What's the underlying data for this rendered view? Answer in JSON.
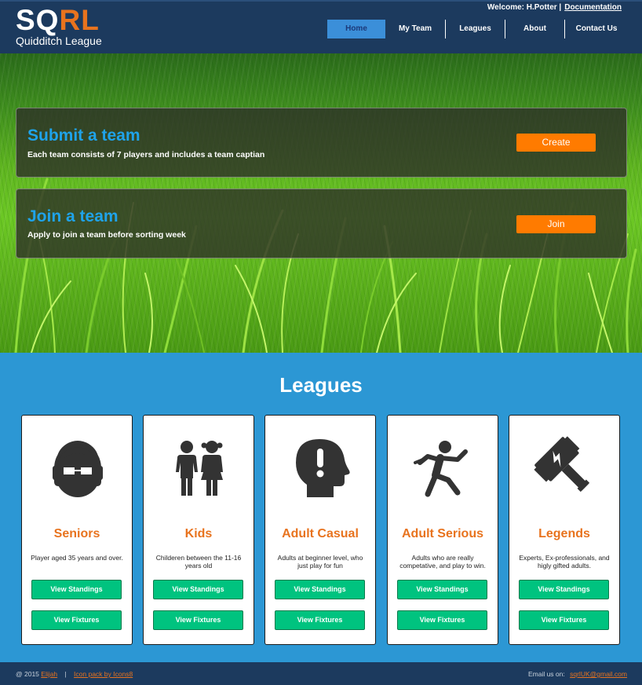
{
  "header": {
    "logo_sq": "SQ",
    "logo_rl": "RL",
    "logo_subtitle": "Quidditch League",
    "welcome_text": "Welcome: H.Potter  |",
    "documentation_link": "Documentation"
  },
  "nav": {
    "items": [
      {
        "label": "Home",
        "active": true
      },
      {
        "label": "My Team",
        "active": false
      },
      {
        "label": "Leagues",
        "active": false
      },
      {
        "label": "About",
        "active": false
      },
      {
        "label": "Contact Us",
        "active": false
      }
    ]
  },
  "hero": {
    "submit": {
      "title": "Submit a team",
      "description": "Each team consists of 7 players and includes a team captian",
      "button": "Create"
    },
    "join": {
      "title": "Join a team",
      "description": "Apply to join a team before sorting week",
      "button": "Join"
    }
  },
  "leagues": {
    "title": "Leagues",
    "cards": [
      {
        "icon": "senior-icon",
        "title": "Seniors",
        "description": "Player aged 35 years and over.",
        "standings_button": "View Standings",
        "fixtures_button": "View Fixtures"
      },
      {
        "icon": "kids-icon",
        "title": "Kids",
        "description": "Childeren between the 11-16 years old",
        "standings_button": "View Standings",
        "fixtures_button": "View Fixtures"
      },
      {
        "icon": "head-exclamation-icon",
        "title": "Adult Casual",
        "description": "Adults at beginner level, who just play for fun",
        "standings_button": "View Standings",
        "fixtures_button": "View Fixtures"
      },
      {
        "icon": "runner-icon",
        "title": "Adult Serious",
        "description": "Adults who are really competative, and play to win.",
        "standings_button": "View Standings",
        "fixtures_button": "View Fixtures"
      },
      {
        "icon": "hammer-icon",
        "title": "Legends",
        "description": "Experts, Ex-professionals, and higly gifted adults.",
        "standings_button": "View Standings",
        "fixtures_button": "View Fixtures"
      }
    ]
  },
  "footer": {
    "copyright": "@ 2015",
    "author_link": "Elijah",
    "separator": "|",
    "icon_credit_link": "Icon pack by Icons8",
    "email_label": "Email us on:",
    "email_link": "sqrlUK@gmail.com"
  },
  "colors": {
    "header_bg": "#1c3a5e",
    "accent_orange": "#e8731e",
    "button_orange": "#ff7b00",
    "title_blue": "#1fa3ea",
    "leagues_bg": "#2c97d4",
    "button_green": "#00c37f"
  }
}
